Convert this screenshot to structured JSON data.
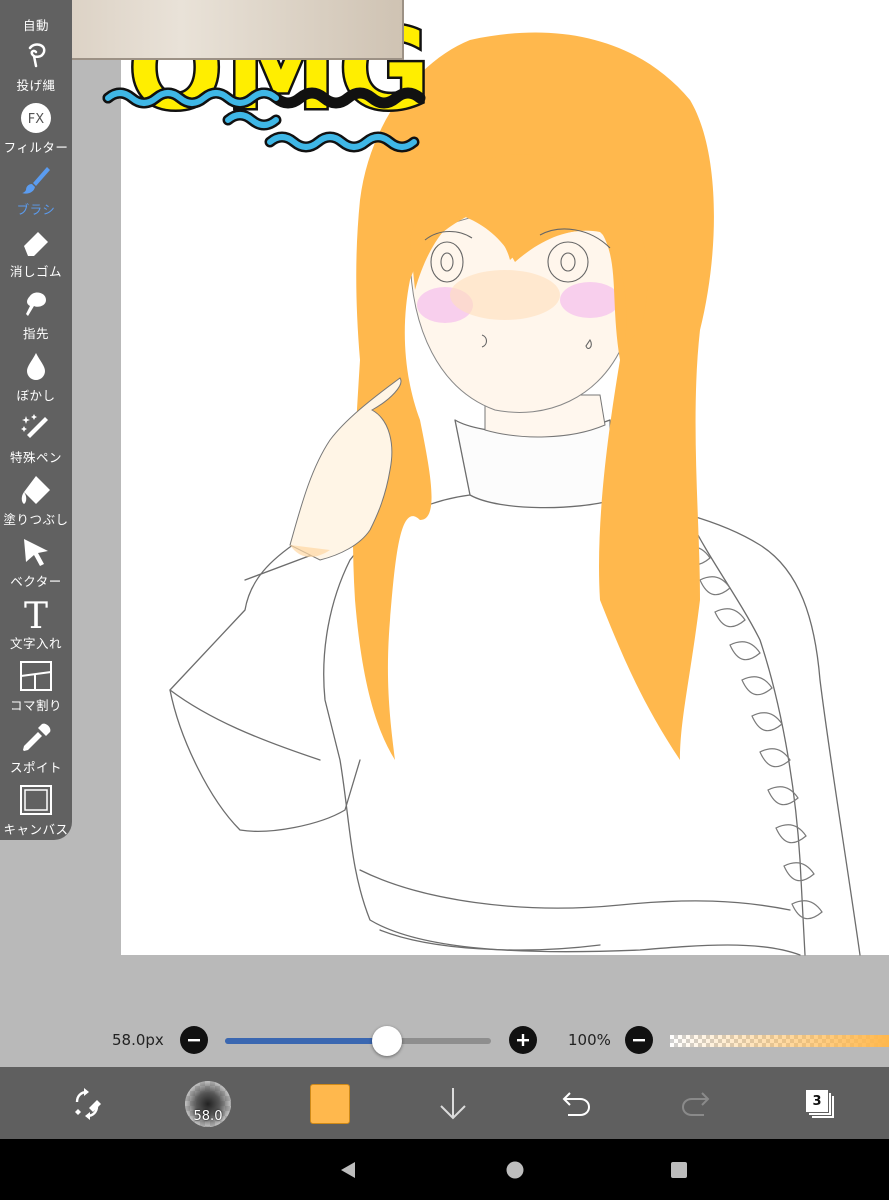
{
  "toolbar": {
    "items": [
      {
        "label": "自動",
        "icon": "auto-select-icon"
      },
      {
        "label": "投げ縄",
        "icon": "lasso-icon"
      },
      {
        "label": "フィルター",
        "icon": "fx-filter-icon",
        "badge": "FX"
      },
      {
        "label": "ブラシ",
        "icon": "brush-icon",
        "active": true
      },
      {
        "label": "消しゴム",
        "icon": "eraser-icon"
      },
      {
        "label": "指先",
        "icon": "finger-smudge-icon"
      },
      {
        "label": "ぼかし",
        "icon": "blur-drop-icon"
      },
      {
        "label": "特殊ペン",
        "icon": "special-pen-icon"
      },
      {
        "label": "塗りつぶし",
        "icon": "fill-bucket-icon"
      },
      {
        "label": "ベクター",
        "icon": "vector-arrow-icon"
      },
      {
        "label": "文字入れ",
        "icon": "text-t-icon",
        "glyph": "T"
      },
      {
        "label": "コマ割り",
        "icon": "panel-divide-icon"
      },
      {
        "label": "スポイト",
        "icon": "eyedropper-icon"
      },
      {
        "label": "キャンバス",
        "icon": "canvas-frame-icon"
      }
    ],
    "active_color": "#5b9cf0"
  },
  "canvas": {
    "sticker_text": "OMG",
    "sticker_fill": "#ffee00",
    "wave_color": "#3fb7e6",
    "hair_color": "#ffb84d"
  },
  "sliders": {
    "brush_size_text": "58.0px",
    "brush_size_fraction": 0.61,
    "opacity_text": "100%",
    "opacity_fraction": 1.0,
    "minus_symbol": "−",
    "plus_symbol": "+"
  },
  "bottombar": {
    "brush_preview_size": "58.0",
    "current_color": "#ffb84d",
    "layer_count": "3",
    "icons": [
      "transform-swap-icon",
      "brush-preview-icon",
      "color-swatch",
      "arrow-down-icon",
      "undo-icon",
      "redo-icon",
      "layers-icon"
    ]
  },
  "system_nav": {
    "icons": [
      "back-triangle-icon",
      "home-circle-icon",
      "recents-square-icon"
    ]
  }
}
